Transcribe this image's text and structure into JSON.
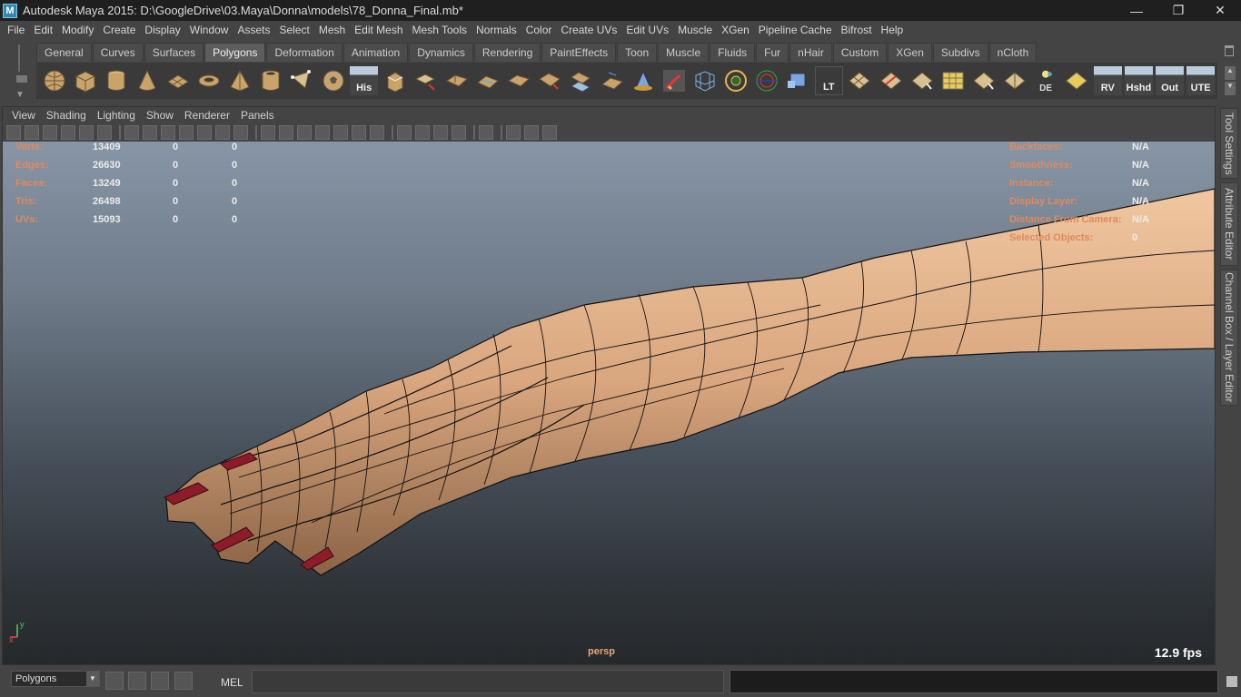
{
  "window": {
    "title": "Autodesk Maya 2015: D:\\GoogleDrive\\03.Maya\\Donna\\models\\78_Donna_Final.mb*",
    "logo_letter": "M",
    "minimize": "—",
    "maximize": "❐",
    "close": "✕"
  },
  "menubar": [
    "File",
    "Edit",
    "Modify",
    "Create",
    "Display",
    "Window",
    "Assets",
    "Select",
    "Mesh",
    "Edit Mesh",
    "Mesh Tools",
    "Normals",
    "Color",
    "Create UVs",
    "Edit UVs",
    "Muscle",
    "XGen",
    "Pipeline Cache",
    "Bifrost",
    "Help"
  ],
  "shelf": {
    "tabs": [
      "General",
      "Curves",
      "Surfaces",
      "Polygons",
      "Deformation",
      "Animation",
      "Dynamics",
      "Rendering",
      "PaintEffects",
      "Toon",
      "Muscle",
      "Fluids",
      "Fur",
      "nHair",
      "Custom",
      "XGen",
      "Subdivs",
      "nCloth"
    ],
    "active_tab": "Polygons",
    "text_buttons": {
      "his": "His",
      "lt": "LT",
      "de": "DE",
      "rv": "RV",
      "hshd": "Hshd",
      "out": "Out",
      "ute": "UTE"
    }
  },
  "panel": {
    "menu": [
      "View",
      "Shading",
      "Lighting",
      "Show",
      "Renderer",
      "Panels"
    ]
  },
  "hud": {
    "left": [
      {
        "label": "Verts:",
        "v1": "13409",
        "v2": "0",
        "v3": "0"
      },
      {
        "label": "Edges:",
        "v1": "26630",
        "v2": "0",
        "v3": "0"
      },
      {
        "label": "Faces:",
        "v1": "13249",
        "v2": "0",
        "v3": "0"
      },
      {
        "label": "Tris:",
        "v1": "26498",
        "v2": "0",
        "v3": "0"
      },
      {
        "label": "UVs:",
        "v1": "15093",
        "v2": "0",
        "v3": "0"
      }
    ],
    "right": [
      {
        "label": "Backfaces:",
        "value": "N/A"
      },
      {
        "label": "Smoothness:",
        "value": "N/A"
      },
      {
        "label": "Instance:",
        "value": "N/A"
      },
      {
        "label": "Display Layer:",
        "value": "N/A"
      },
      {
        "label": "Distance From Camera:",
        "value": "N/A"
      },
      {
        "label": "Selected Objects:",
        "value": "0"
      }
    ],
    "camera": "persp",
    "fps": "12.9 fps",
    "axis_x": "x",
    "axis_y": "y"
  },
  "side_tabs": [
    "Tool Settings",
    "Attribute Editor",
    "Channel Box / Layer Editor"
  ],
  "command_line": {
    "mode": "Polygons",
    "language": "MEL"
  },
  "colors": {
    "hud_label": "#e08a5e",
    "skin": "#d9a67e",
    "nail": "#8c1c2a",
    "viewport_top": "#8795a6",
    "viewport_bottom": "#26292c"
  }
}
